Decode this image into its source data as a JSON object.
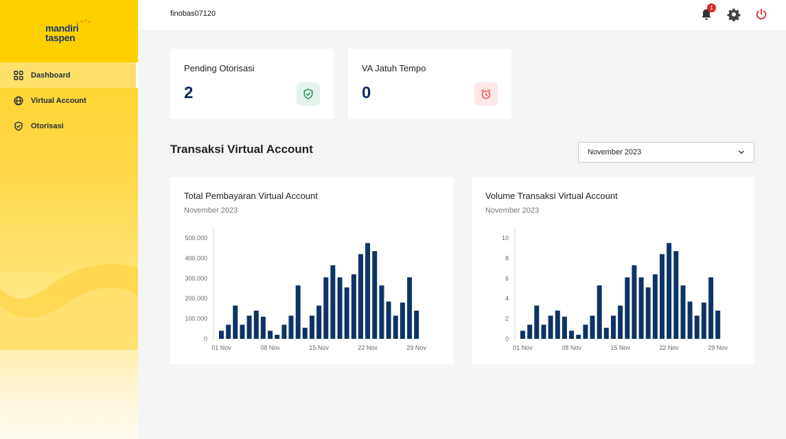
{
  "brand": {
    "line1": "mandiri",
    "line2": "taspen"
  },
  "sidebar": {
    "items": [
      {
        "label": "Dashboard",
        "icon": "grid-icon",
        "active": true
      },
      {
        "label": "Virtual Account",
        "icon": "globe-icon",
        "active": false
      },
      {
        "label": "Otorisasi",
        "icon": "shield-check-icon",
        "active": false
      }
    ]
  },
  "header": {
    "username": "finobas07120",
    "notification_count": "1",
    "icons": [
      "bell-icon",
      "gear-icon",
      "power-icon"
    ]
  },
  "stats": {
    "pending": {
      "title": "Pending Otorisasi",
      "value": "2",
      "icon": "shield-check-icon",
      "icon_bg": "#e4f3ec",
      "icon_color": "#1e8e4e"
    },
    "jatuh_tempo": {
      "title": "VA Jatuh Tempo",
      "value": "0",
      "icon": "alarm-clock-icon",
      "icon_bg": "#fde7e7",
      "icon_color": "#e53e3e"
    }
  },
  "section": {
    "title": "Transaksi Virtual Account",
    "month_select": {
      "value": "November 2023"
    }
  },
  "colors": {
    "bar": "#0d3466",
    "accent": "#ffd000"
  },
  "chart_data": [
    {
      "type": "bar",
      "title": "Total Pembayaran Virtual Account",
      "subtitle": "November 2023",
      "x_tick_labels": [
        "01 Nov",
        "08 Nov",
        "15 Nov",
        "22 Nov",
        "29 Nov"
      ],
      "x_tick_positions": [
        1,
        8,
        15,
        22,
        29
      ],
      "y_tick_labels": [
        "0",
        "100.000",
        "200.000",
        "300.000",
        "400.000",
        "500.000"
      ],
      "ylim": [
        0,
        500000
      ],
      "x": [
        1,
        2,
        3,
        4,
        5,
        6,
        7,
        8,
        9,
        10,
        11,
        12,
        13,
        14,
        15,
        16,
        17,
        18,
        19,
        20,
        21,
        22,
        23,
        24,
        25,
        26,
        27,
        28,
        29,
        30
      ],
      "values": [
        40000,
        70000,
        165000,
        70000,
        115000,
        140000,
        110000,
        40000,
        20000,
        70000,
        115000,
        265000,
        55000,
        115000,
        165000,
        305000,
        365000,
        305000,
        255000,
        320000,
        420000,
        475000,
        435000,
        265000,
        185000,
        115000,
        180000,
        305000,
        140000,
        0
      ],
      "grid": false
    },
    {
      "type": "bar",
      "title": "Volume Transaksi Virtual Account",
      "subtitle": "November 2023",
      "x_tick_labels": [
        "01 Nov",
        "08 Nov",
        "15 Nov",
        "22 Nov",
        "29 Nov"
      ],
      "x_tick_positions": [
        1,
        8,
        15,
        22,
        29
      ],
      "y_tick_labels": [
        "0",
        "2",
        "4",
        "6",
        "8",
        "10"
      ],
      "ylim": [
        0,
        10
      ],
      "x": [
        1,
        2,
        3,
        4,
        5,
        6,
        7,
        8,
        9,
        10,
        11,
        12,
        13,
        14,
        15,
        16,
        17,
        18,
        19,
        20,
        21,
        22,
        23,
        24,
        25,
        26,
        27,
        28,
        29,
        30
      ],
      "values": [
        0.8,
        1.4,
        3.3,
        1.4,
        2.3,
        2.8,
        2.2,
        0.8,
        0.4,
        1.4,
        2.3,
        5.3,
        1.1,
        2.3,
        3.3,
        6.1,
        7.3,
        6.1,
        5.1,
        6.4,
        8.4,
        9.5,
        8.7,
        5.3,
        3.7,
        2.3,
        3.6,
        6.1,
        2.8,
        0
      ],
      "grid": false
    }
  ]
}
